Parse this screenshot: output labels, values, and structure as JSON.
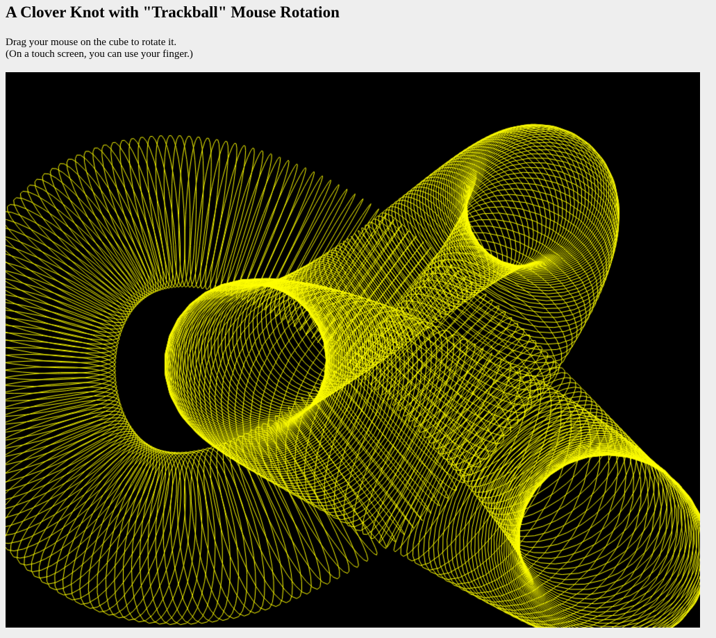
{
  "page": {
    "title": "A Clover Knot with \"Trackball\" Mouse Rotation",
    "instruction_line1": "Drag your mouse on the cube to rotate it.",
    "instruction_line2": "(On a touch screen, you can use your finger.)"
  },
  "canvas": {
    "background_color": "#000000",
    "stroke_color": "#ffff00",
    "shape": "clover-knot"
  }
}
